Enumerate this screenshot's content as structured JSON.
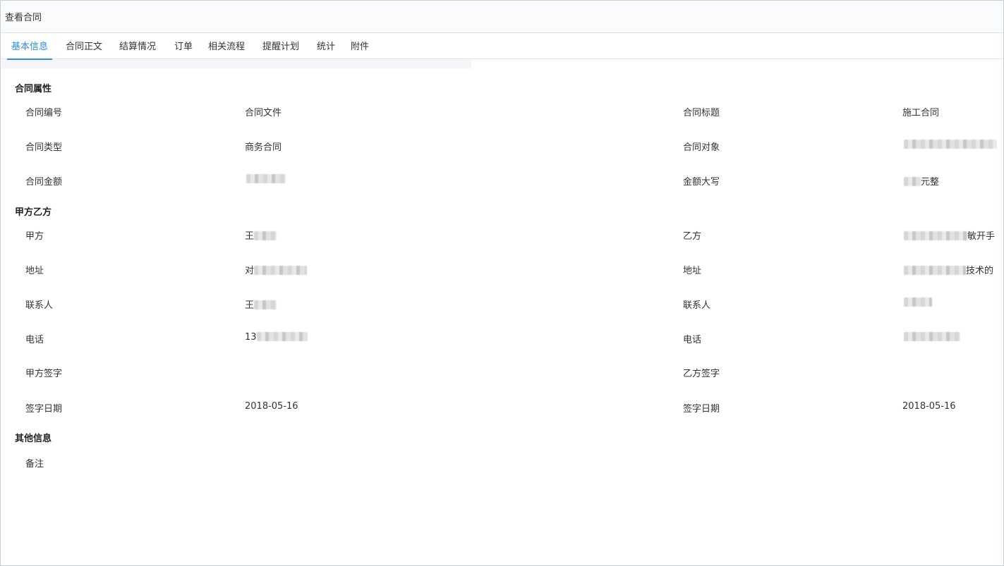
{
  "window": {
    "title": "查看合同"
  },
  "tabs": [
    {
      "label": "基本信息",
      "active": true
    },
    {
      "label": "合同正文"
    },
    {
      "label": "结算情况"
    },
    {
      "label": "订单"
    },
    {
      "label": "相关流程"
    },
    {
      "label": "提醒计划"
    },
    {
      "label": "统计"
    },
    {
      "label": "附件"
    }
  ],
  "accent_color": "#2d8cf0",
  "sections": {
    "contract": {
      "title": "合同属性",
      "fields": {
        "number": {
          "label": "合同编号",
          "value": "合同文件"
        },
        "title": {
          "label": "合同标题",
          "value": "施工合同"
        },
        "type": {
          "label": "合同类型",
          "value": "商务合同"
        },
        "object": {
          "label": "合同对象",
          "value": ""
        },
        "amount": {
          "label": "合同金额",
          "value": ""
        },
        "amount_caps": {
          "label": "金额大写",
          "value": "元整"
        }
      }
    },
    "parties": {
      "title": "甲方乙方",
      "fields": {
        "party_a": {
          "label": "甲方",
          "value": "王"
        },
        "party_b": {
          "label": "乙方",
          "value": "敏开手"
        },
        "address_a": {
          "label": "地址",
          "value": "对"
        },
        "address_b": {
          "label": "地址",
          "value": "技术的"
        },
        "contact_a": {
          "label": "联系人",
          "value": "王"
        },
        "contact_b": {
          "label": "联系人",
          "value": ""
        },
        "phone_a": {
          "label": "电话",
          "value": "13"
        },
        "phone_b": {
          "label": "电话",
          "value": ""
        },
        "sign_a": {
          "label": "甲方签字",
          "value": ""
        },
        "sign_b": {
          "label": "乙方签字",
          "value": ""
        },
        "date_a": {
          "label": "签字日期",
          "value": "2018-05-16"
        },
        "date_b": {
          "label": "签字日期",
          "value": "2018-05-16"
        }
      }
    },
    "other": {
      "title": "其他信息",
      "fields": {
        "remark": {
          "label": "备注",
          "value": ""
        }
      }
    }
  }
}
